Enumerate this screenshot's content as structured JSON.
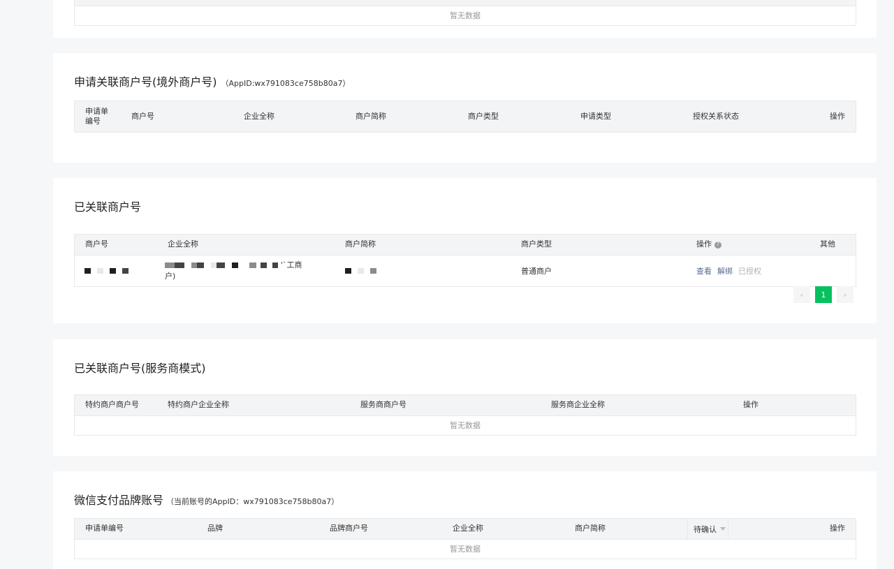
{
  "top_section": {
    "empty_text": "暂无数据"
  },
  "overseas": {
    "title": "申请关联商户号(境外商户号)",
    "appid_note": "（AppID:wx791083ce758b80a7）",
    "headers": [
      "申请单编号",
      "商户号",
      "企业全称",
      "商户简称",
      "商户类型",
      "申请类型",
      "授权关系状态",
      "操作"
    ]
  },
  "linked": {
    "title": "已关联商户号",
    "headers": [
      "商户号",
      "企业全称",
      "商户简称",
      "商户类型",
      "操作",
      "其他"
    ],
    "row": {
      "name_suffix_1": "'`工商",
      "name_suffix_2": "户)",
      "merchant_type": "普通商户",
      "actions": {
        "view": "查看",
        "unbind": "解绑",
        "authorized": "已授权"
      }
    },
    "pagination": {
      "prev": "‹",
      "current": "1",
      "next": "›"
    },
    "help_icon": "question-circle-icon"
  },
  "service_mode": {
    "title": "已关联商户号(服务商模式)",
    "headers": [
      "特约商户商户号",
      "特约商户企业全称",
      "服务商商户号",
      "服务商企业全称",
      "操作"
    ],
    "empty_text": "暂无数据"
  },
  "brand": {
    "title": "微信支付品牌账号",
    "appid_note": "（当前账号的AppID：wx791083ce758b80a7）",
    "headers": [
      "申请单编号",
      "品牌",
      "品牌商户号",
      "企业全称",
      "商户简称",
      "操作"
    ],
    "filter_label": "待确认",
    "empty_text": "暂无数据"
  },
  "colors": {
    "accent": "#07c160",
    "link": "#576b95",
    "header_bg": "#f3f4f6"
  }
}
